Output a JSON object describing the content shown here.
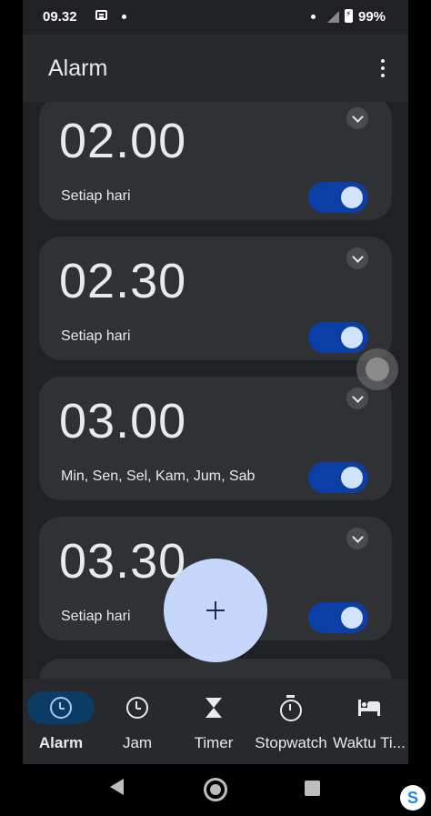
{
  "status_bar": {
    "time": "09.32",
    "battery": "99%",
    "icons": [
      "message-icon",
      "notification-dot-icon",
      "signal-icon",
      "battery-charging-icon"
    ]
  },
  "app_bar": {
    "title": "Alarm",
    "menu_icon": "more-vert-icon"
  },
  "alarms": [
    {
      "time": "02.00",
      "days": "Setiap hari",
      "enabled": true
    },
    {
      "time": "02.30",
      "days": "Setiap hari",
      "enabled": true
    },
    {
      "time": "03.00",
      "days": "Min, Sen, Sel, Kam, Jum, Sab",
      "enabled": true
    },
    {
      "time": "03.30",
      "days": "Setiap hari",
      "enabled": true
    }
  ],
  "fab": {
    "icon": "plus-icon",
    "label": "+"
  },
  "bottom_nav": {
    "items": [
      {
        "label": "Alarm",
        "icon": "alarm-clock-icon",
        "active": true
      },
      {
        "label": "Jam",
        "icon": "clock-icon",
        "active": false
      },
      {
        "label": "Timer",
        "icon": "hourglass-icon",
        "active": false
      },
      {
        "label": "Stopwatch",
        "icon": "stopwatch-icon",
        "active": false
      },
      {
        "label": "Waktu Ti...",
        "icon": "bed-icon",
        "active": false
      }
    ]
  },
  "system_nav": {
    "icons": [
      "back-icon",
      "home-icon",
      "recents-icon"
    ]
  },
  "corner_badge": "S",
  "colors": {
    "background": "#202124",
    "card": "#303134",
    "toggle_on": "#0b3fa6",
    "fab": "#c5d8fb",
    "nav_active_pill": "#0b3c64"
  }
}
